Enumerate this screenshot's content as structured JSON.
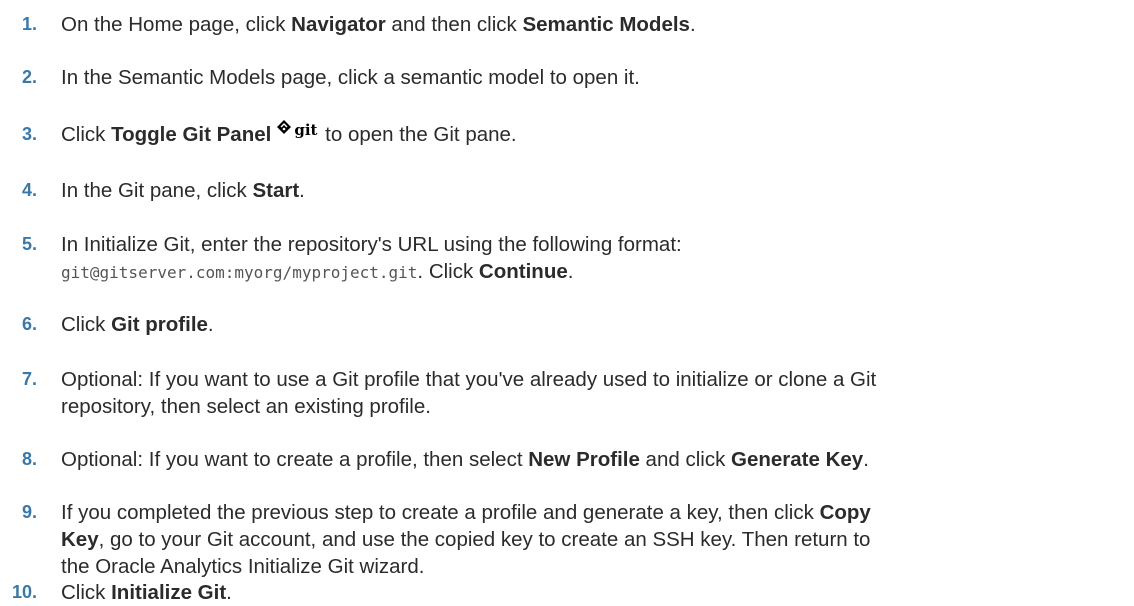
{
  "steps": [
    {
      "number": "1.",
      "parts": [
        "On the Home page, click ",
        "Navigator",
        " and then click ",
        "Semantic Models",
        "."
      ]
    },
    {
      "number": "2.",
      "text": "In the Semantic Models page, click a semantic model to open it."
    },
    {
      "number": "3.",
      "parts": [
        "Click ",
        "Toggle Git Panel",
        " to open the Git pane."
      ],
      "icon": "git-toggle-icon",
      "icon_label": "git"
    },
    {
      "number": "4.",
      "parts": [
        "In the Git pane, click ",
        "Start",
        "."
      ]
    },
    {
      "number": "5.",
      "parts": [
        "In Initialize Git, enter the repository's URL using the following format:",
        "git@gitserver.com:myorg/myproject.git",
        ". Click ",
        "Continue",
        "."
      ]
    },
    {
      "number": "6.",
      "parts": [
        "Click ",
        "Git profile",
        "."
      ]
    },
    {
      "number": "7.",
      "lines": [
        "Optional: If you want to use a Git profile that you've already used to initialize or clone a Git",
        "repository, then select an existing profile."
      ]
    },
    {
      "number": "8.",
      "parts": [
        "Optional: If you want to create a profile, then select ",
        "New Profile",
        " and click ",
        "Generate Key",
        "."
      ]
    },
    {
      "number": "9.",
      "parts": [
        "If you completed the previous step to create a profile and generate a key, then click ",
        "Copy",
        "Key",
        ", go to your Git account, and use the copied key to create an SSH key. Then return to",
        "the Oracle Analytics Initialize Git wizard."
      ]
    },
    {
      "number": "10.",
      "parts": [
        "Click ",
        "Initialize Git",
        "."
      ]
    }
  ],
  "colors": {
    "step_number": "#3a78a8",
    "text": "#2b2b2b",
    "code": "#555555"
  }
}
